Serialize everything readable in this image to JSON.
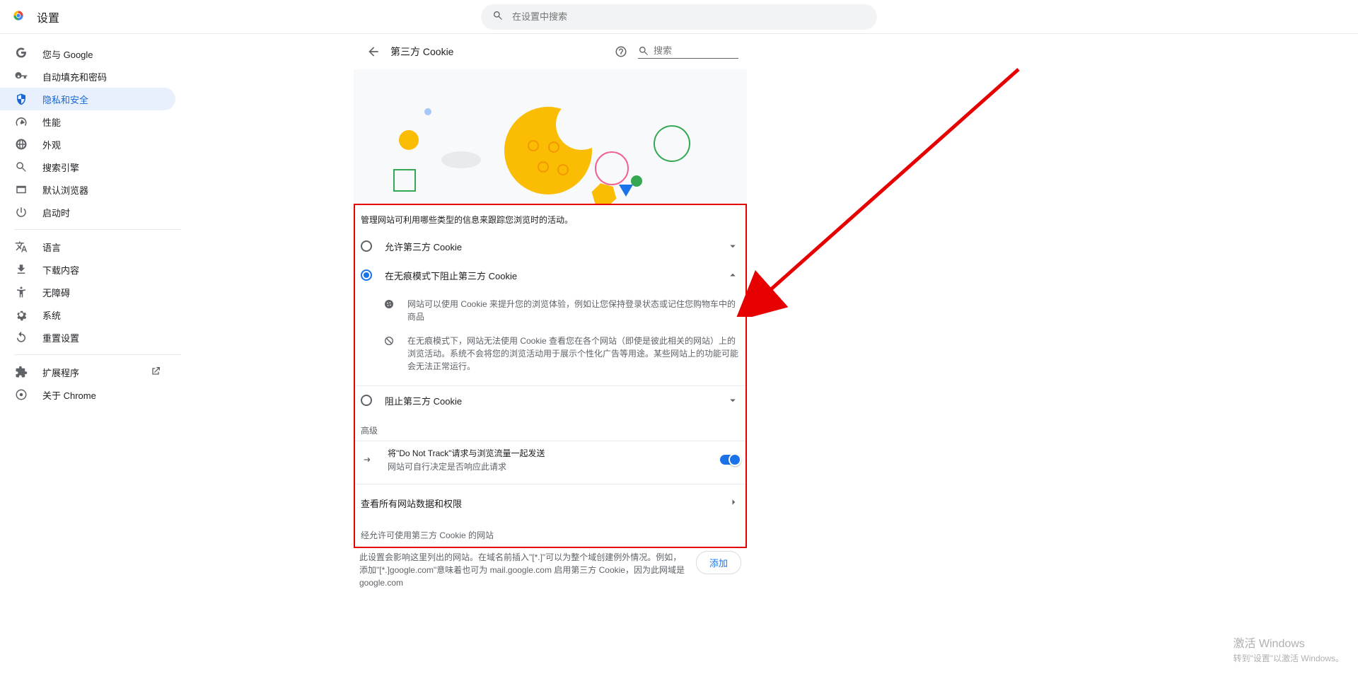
{
  "top": {
    "title": "设置",
    "search_placeholder": "在设置中搜索"
  },
  "sidebar": {
    "items": [
      {
        "label": "您与 Google"
      },
      {
        "label": "自动填充和密码"
      },
      {
        "label": "隐私和安全"
      },
      {
        "label": "性能"
      },
      {
        "label": "外观"
      },
      {
        "label": "搜索引擎"
      },
      {
        "label": "默认浏览器"
      },
      {
        "label": "启动时"
      }
    ],
    "group2": [
      {
        "label": "语言"
      },
      {
        "label": "下载内容"
      },
      {
        "label": "无障碍"
      },
      {
        "label": "系统"
      },
      {
        "label": "重置设置"
      }
    ],
    "group3": [
      {
        "label": "扩展程序"
      },
      {
        "label": "关于 Chrome"
      }
    ]
  },
  "panel": {
    "title": "第三方 Cookie",
    "search_placeholder": "搜索"
  },
  "hl": {
    "desc": "管理网站可利用哪些类型的信息来跟踪您浏览时的活动。",
    "opt1": "允许第三方 Cookie",
    "opt2": "在无痕模式下阻止第三方 Cookie",
    "sub1": "网站可以使用 Cookie 来提升您的浏览体验，例如让您保持登录状态或记住您购物车中的商品",
    "sub2": "在无痕模式下，网站无法使用 Cookie 查看您在各个网站（即使是彼此相关的网站）上的浏览活动。系统不会将您的浏览活动用于展示个性化广告等用途。某些网站上的功能可能会无法正常运行。",
    "opt3": "阻止第三方 Cookie",
    "adv": "高级",
    "dnt_l1": "将\"Do Not Track\"请求与浏览流量一起发送",
    "dnt_l2": "网站可自行决定是否响应此请求",
    "view_all": "查看所有网站数据和权限",
    "allow_header": "经允许可使用第三方 Cookie 的网站"
  },
  "below": {
    "text": "此设置会影响这里列出的网站。在域名前插入\"[*.]\"可以为整个域创建例外情况。例如，添加\"[*.]google.com\"意味着也可为 mail.google.com 启用第三方 Cookie，因为此网域是 google.com",
    "add": "添加"
  },
  "wm": {
    "l1": "激活 Windows",
    "l2": "转到\"设置\"以激活 Windows。"
  }
}
